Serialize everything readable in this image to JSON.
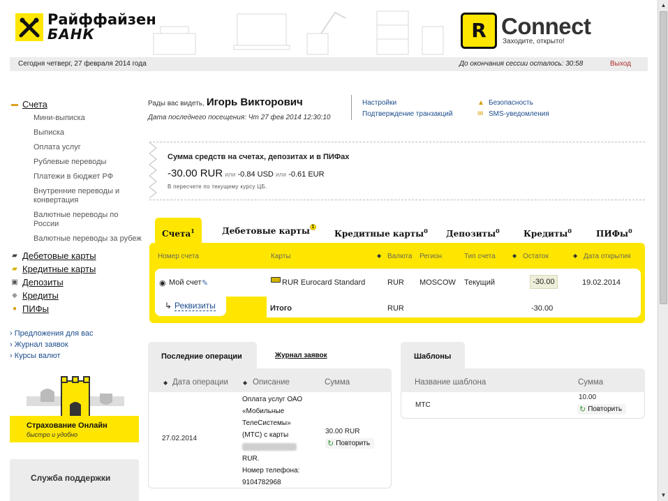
{
  "header": {
    "logo_line1": "Райффайзен",
    "logo_line2": "БАНК",
    "rconnect_letter": "R",
    "rconnect_title": "Connect",
    "rconnect_slogan": "Заходите, открыто!"
  },
  "infobar": {
    "date": "Сегодня четверг, 27 февраля 2014 года",
    "session": "До окончания сессии осталось: 30:58",
    "logout": "Выход"
  },
  "nav": {
    "accounts": "Счета",
    "sub": [
      "Мини-выписка",
      "Выписка",
      "Оплата услуг",
      "Рублевые переводы",
      "Платежи в бюджет РФ",
      "Внутренние переводы и конвертация",
      "Валютные переводы по России",
      "Валютные переводы за рубеж"
    ],
    "debit": "Дебетовые карты",
    "credit_cards": "Кредитные карты",
    "deposits": "Депозиты",
    "credits": "Кредиты",
    "funds": "ПИФы",
    "links": [
      "Предложения для вас",
      "Журнал заявок",
      "Курсы валют"
    ],
    "insurance_title": "Страхование Онлайн",
    "insurance_sub": "быстро и удобно",
    "support": "Служба поддержки"
  },
  "greeting": {
    "hello": "Рады вас видеть,",
    "name": "Игорь Викторович",
    "last_visit": "Дата последнего посещения: Чт 27 фев 2014 12:30:10",
    "settings": "Настройки",
    "confirm": "Подтверждение транзакций",
    "security": "Безопасность",
    "sms": "SMS-уведомления"
  },
  "summary": {
    "title": "Сумма средств на счетах, депозитах и в ПИФах",
    "rur": "-30.00 RUR",
    "or1": "или",
    "usd": "-0.84 USD",
    "or2": "или",
    "eur": "-0.61 EUR",
    "note": "В пересчете по текущему курсу ЦБ."
  },
  "tabs": [
    {
      "label": "Счета",
      "count": "1"
    },
    {
      "label": "Дебетовые карты",
      "count": "1"
    },
    {
      "label": "Кредитные карты",
      "count": "0"
    },
    {
      "label": "Депозиты",
      "count": "0"
    },
    {
      "label": "Кредиты",
      "count": "0"
    },
    {
      "label": "ПИФы",
      "count": "0"
    }
  ],
  "accounts": {
    "headers": [
      "Номер счета",
      "Карты",
      "Валюта",
      "Регион",
      "Тип счета",
      "Остаток",
      "Дата открытия"
    ],
    "row": {
      "account": "Мой счет",
      "card": "RUR Eurocard Standard",
      "currency": "RUR",
      "region": "MOSCOW",
      "type": "Текущий",
      "balance": "-30.00",
      "opened": "19.02.2014"
    },
    "details": "Реквизиты",
    "total_label": "Итого",
    "total_currency": "RUR",
    "total_balance": "-30.00"
  },
  "ops": {
    "tab": "Последние операции",
    "journal": "Журнал заявок",
    "headers": [
      "Дата операции",
      "Описание",
      "Сумма"
    ],
    "date": "27.02.2014",
    "desc_lines": [
      "Оплата услуг ОАО",
      "«Мобильные",
      "ТелеСистемы»",
      "(МТС) с карты"
    ],
    "desc_tail": [
      "RUR.",
      "Номер телефона:",
      "9104782968"
    ],
    "amount": "30.00 RUR",
    "repeat": "Повторить"
  },
  "templates": {
    "tab": "Шаблоны",
    "headers": [
      "Название шаблона",
      "Сумма"
    ],
    "name": "МТС",
    "amount": "10.00",
    "repeat": "Повторить"
  },
  "colors": {
    "brand_yellow": "#fee600",
    "link": "#1a4b8c",
    "logout": "#b22a2a"
  }
}
